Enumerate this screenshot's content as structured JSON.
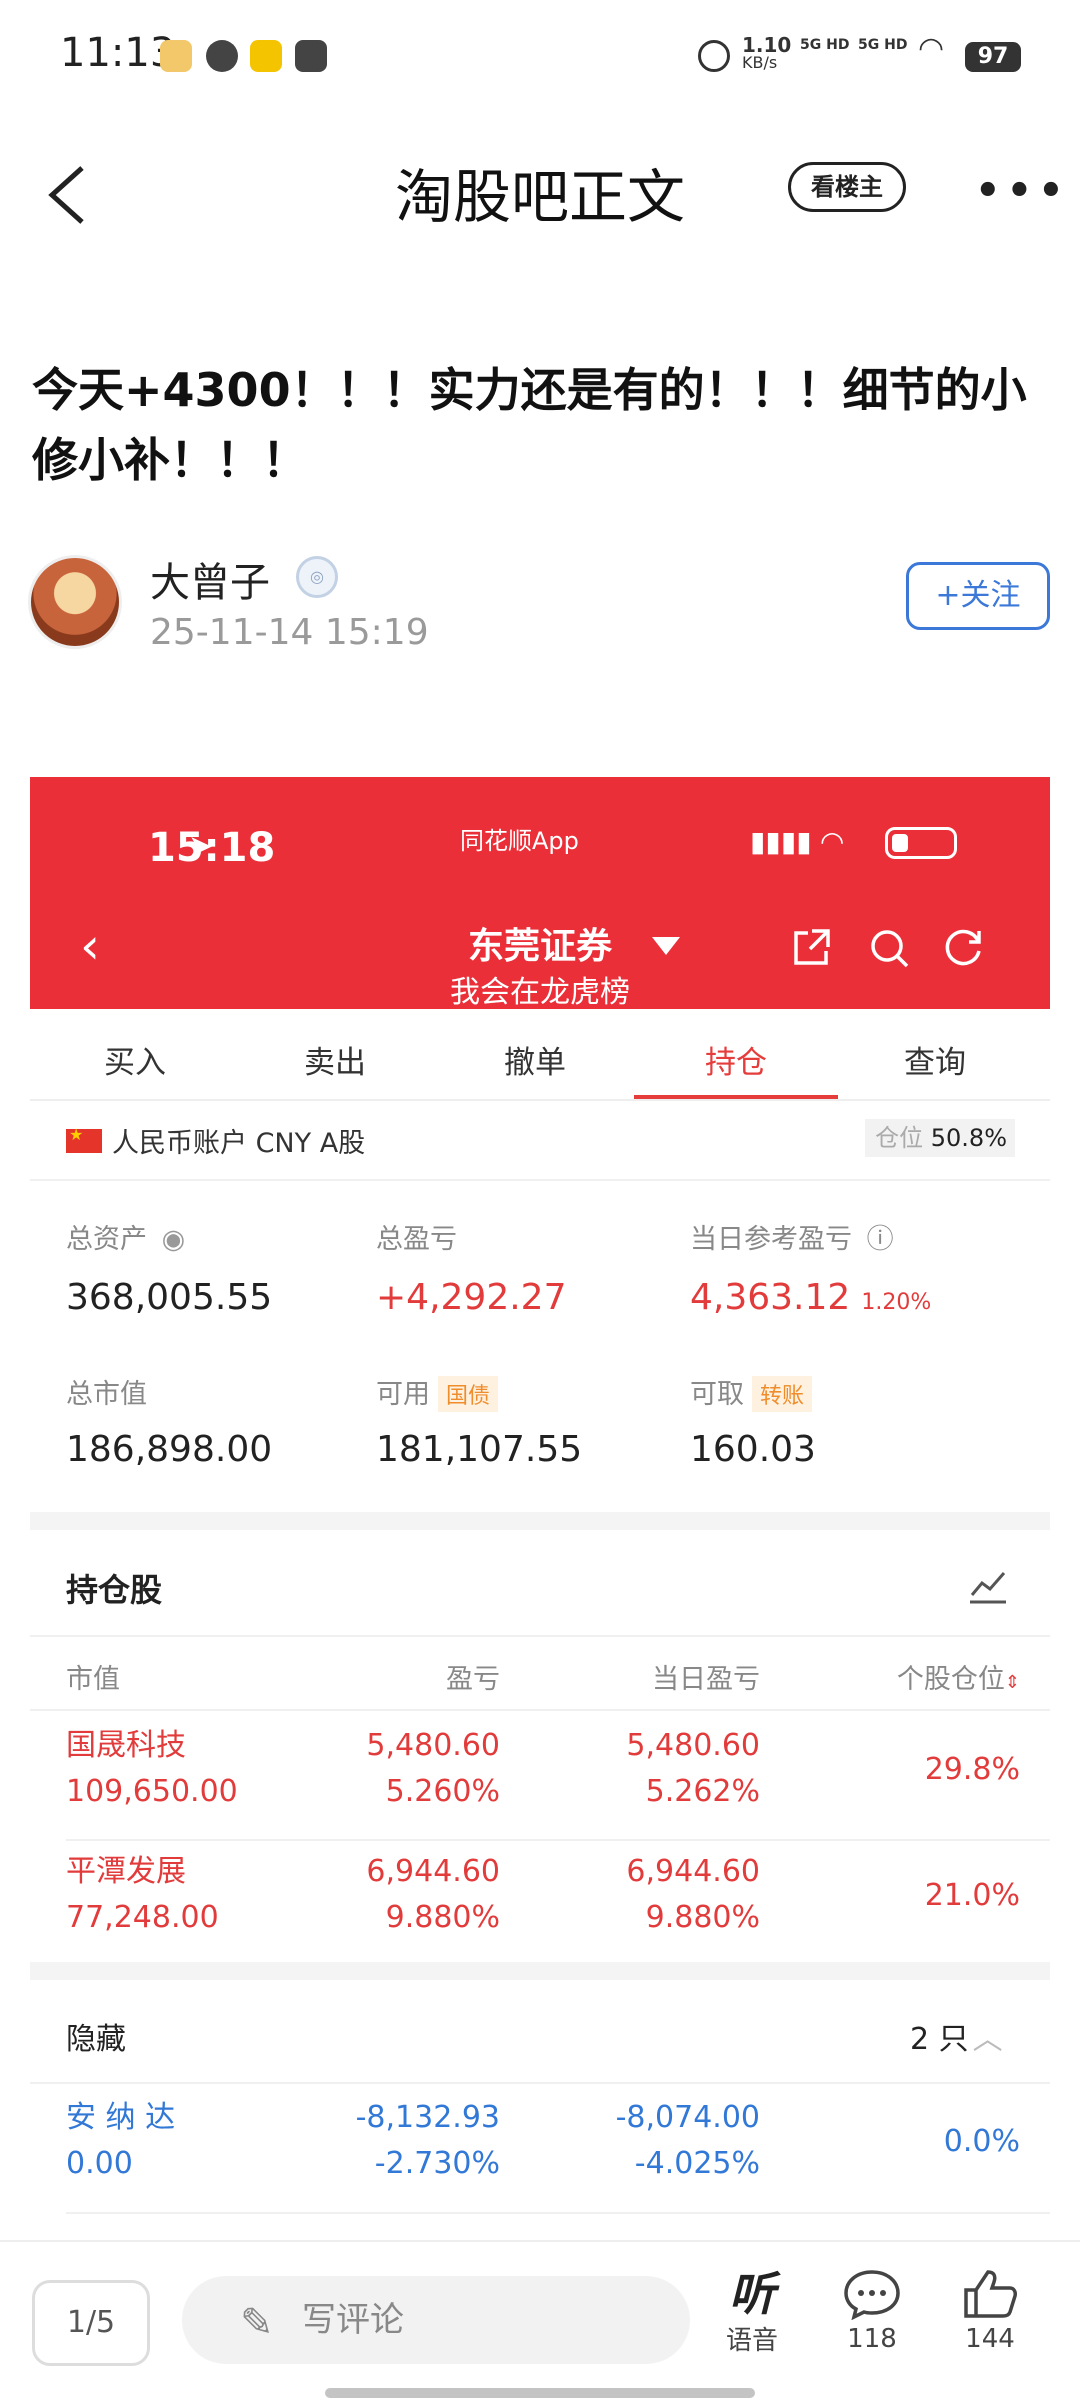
{
  "status_bar": {
    "time": "11:13",
    "net_speed": "1.10",
    "net_unit": "KB/s",
    "sim1": "5G HD",
    "sim2": "5G HD",
    "battery": "97"
  },
  "nav": {
    "title": "淘股吧正文",
    "op_only_button": "看楼主"
  },
  "post": {
    "title": "今天+4300！！！实力还是有的！！！细节的小修小补！！！",
    "author": "大曾子",
    "date": "25-11-14 15:19",
    "follow_button": "+关注"
  },
  "screenshot": {
    "time": "15:18",
    "app_name": "同花顺App",
    "broker": "东莞证券",
    "subtitle": "我会在龙虎榜",
    "tabs": [
      "买入",
      "卖出",
      "撤单",
      "持仓",
      "查询"
    ],
    "active_tab": "持仓",
    "account_label": "人民币账户 CNY A股",
    "position_label": "仓位",
    "position_value": "50.8%",
    "summary": {
      "total_assets_label": "总资产",
      "total_assets": "368,005.55",
      "total_pnl_label": "总盈亏",
      "total_pnl": "+4,292.27",
      "daily_pnl_label": "当日参考盈亏",
      "daily_pnl": "4,363.12",
      "daily_pnl_pct": "1.20%",
      "market_value_label": "总市值",
      "market_value": "186,898.00",
      "available_label": "可用",
      "available_tag": "国债",
      "available": "181,107.55",
      "withdrawable_label": "可取",
      "withdrawable_tag": "转账",
      "withdrawable": "160.03"
    },
    "holdings_title": "持仓股",
    "headers": [
      "市值",
      "盈亏",
      "当日盈亏",
      "个股仓位"
    ],
    "holdings": [
      {
        "name": "国晟科技",
        "value": "109,650.00",
        "pnl": "5,480.60",
        "pnl_pct": "5.260%",
        "day_pnl": "5,480.60",
        "day_pct": "5.262%",
        "weight": "29.8%"
      },
      {
        "name": "平潭发展",
        "value": "77,248.00",
        "pnl": "6,944.60",
        "pnl_pct": "9.880%",
        "day_pnl": "6,944.60",
        "day_pct": "9.880%",
        "weight": "21.0%"
      }
    ],
    "hidden_label": "隐藏",
    "hidden_count": "2 只",
    "hidden": [
      {
        "name": "安 纳 达",
        "value": "0.00",
        "pnl": "-8,132.93",
        "pnl_pct": "-2.730%",
        "day_pnl": "-8,074.00",
        "day_pct": "-4.025%",
        "weight": "0.0%"
      }
    ]
  },
  "bottom_bar": {
    "page": "1/5",
    "comment_placeholder": "写评论",
    "listen_label": "语音",
    "listen_glyph": "听",
    "comments": "118",
    "likes": "144"
  },
  "colors": {
    "red": "#ea2f39",
    "gain": "#e23b3b",
    "blue": "#3278d6",
    "orange": "#ef8d2c"
  }
}
